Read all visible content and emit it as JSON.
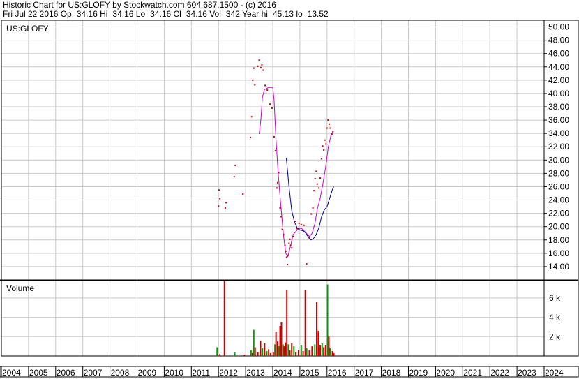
{
  "header": {
    "line1": "Historic Chart for US:GLOFY by Stockwatch.com 604.687.1500 - (c) 2016",
    "line2": "Fri Jul 22 2016  Op=34.16  Hi=34.16  Lo=34.16  Cl=34.16  Vol=342  Year hi=45.13  lo=13.52"
  },
  "colors": {
    "grid": "#c8c8c8",
    "price": "#cc0000",
    "ma_fast": "#cc00cc",
    "ma_slow": "#000099",
    "vol_up": "#00a000",
    "vol_down": "#cc0000",
    "frame": "#000000"
  },
  "chart_data": [
    {
      "type": "scatter",
      "title": "US:GLOFY",
      "ylim": [
        12,
        51
      ],
      "xlim": [
        2004,
        2024
      ],
      "y_ticks": [
        "14.00",
        "16.00",
        "18.00",
        "20.00",
        "22.00",
        "24.00",
        "26.00",
        "28.00",
        "30.00",
        "32.00",
        "34.00",
        "36.00",
        "38.00",
        "40.00",
        "42.00",
        "44.00",
        "46.00",
        "48.00",
        "50.00"
      ],
      "grid": true,
      "series": [
        {
          "kind": "price",
          "points": [
            [
              2012.0,
              23.1
            ],
            [
              2012.02,
              25.5
            ],
            [
              2012.05,
              24.2
            ],
            [
              2012.25,
              22.8
            ],
            [
              2012.28,
              23.6
            ],
            [
              2012.58,
              27.5
            ],
            [
              2012.62,
              29.2
            ],
            [
              2012.9,
              24.9
            ],
            [
              2013.18,
              33.4
            ],
            [
              2013.22,
              36.5
            ],
            [
              2013.26,
              42.0
            ],
            [
              2013.3,
              43.8
            ],
            [
              2013.34,
              41.3
            ],
            [
              2013.45,
              44.1
            ],
            [
              2013.5,
              45.0
            ],
            [
              2013.56,
              43.9
            ],
            [
              2013.6,
              44.3
            ],
            [
              2013.65,
              43.5
            ],
            [
              2013.72,
              41.2
            ],
            [
              2013.8,
              40.5
            ],
            [
              2013.9,
              38.4
            ],
            [
              2013.97,
              37.8
            ],
            [
              2014.05,
              33.5
            ],
            [
              2014.1,
              31.4
            ],
            [
              2014.15,
              25.8
            ],
            [
              2014.18,
              26.6
            ],
            [
              2014.22,
              28.1
            ],
            [
              2014.27,
              22.8
            ],
            [
              2014.31,
              21.5
            ],
            [
              2014.35,
              19.6
            ],
            [
              2014.4,
              18.8
            ],
            [
              2014.45,
              17.2
            ],
            [
              2014.48,
              16.3
            ],
            [
              2014.51,
              15.4
            ],
            [
              2014.54,
              14.3
            ],
            [
              2014.57,
              15.7
            ],
            [
              2014.6,
              17.5
            ],
            [
              2014.63,
              18.1
            ],
            [
              2014.66,
              17.2
            ],
            [
              2014.7,
              16.8
            ],
            [
              2014.75,
              18.5
            ],
            [
              2014.82,
              20.8
            ],
            [
              2014.9,
              19.7
            ],
            [
              2014.97,
              20.5
            ],
            [
              2015.05,
              20.3
            ],
            [
              2015.15,
              20.2
            ],
            [
              2015.25,
              14.4
            ],
            [
              2015.35,
              18.3
            ],
            [
              2015.42,
              21.9
            ],
            [
              2015.48,
              22.8
            ],
            [
              2015.52,
              25.4
            ],
            [
              2015.56,
              27.2
            ],
            [
              2015.6,
              28.3
            ],
            [
              2015.64,
              26.4
            ],
            [
              2015.7,
              25.8
            ],
            [
              2015.75,
              27.3
            ],
            [
              2015.8,
              30.2
            ],
            [
              2015.84,
              32.1
            ],
            [
              2015.88,
              31.5
            ],
            [
              2015.92,
              33.0
            ],
            [
              2015.96,
              32.4
            ],
            [
              2016.0,
              34.8
            ],
            [
              2016.04,
              36.0
            ],
            [
              2016.08,
              35.4
            ],
            [
              2016.12,
              34.8
            ],
            [
              2016.18,
              33.9
            ],
            [
              2016.22,
              34.3
            ]
          ]
        },
        {
          "kind": "ma_fast",
          "points": [
            [
              2013.5,
              33.9
            ],
            [
              2013.56,
              36.0
            ],
            [
              2013.62,
              39.5
            ],
            [
              2013.7,
              40.6
            ],
            [
              2013.85,
              40.9
            ],
            [
              2014.0,
              40.9
            ],
            [
              2014.05,
              39.0
            ],
            [
              2014.12,
              33.0
            ],
            [
              2014.2,
              28.0
            ],
            [
              2014.3,
              23.0
            ],
            [
              2014.4,
              18.5
            ],
            [
              2014.48,
              16.0
            ],
            [
              2014.55,
              15.5
            ],
            [
              2014.65,
              17.0
            ],
            [
              2014.75,
              18.8
            ],
            [
              2014.9,
              19.5
            ],
            [
              2015.05,
              19.8
            ],
            [
              2015.2,
              19.2
            ],
            [
              2015.35,
              18.5
            ],
            [
              2015.45,
              19.0
            ],
            [
              2015.55,
              20.4
            ],
            [
              2015.65,
              22.8
            ],
            [
              2015.75,
              24.3
            ],
            [
              2015.85,
              26.5
            ],
            [
              2015.95,
              29.0
            ],
            [
              2016.05,
              32.0
            ],
            [
              2016.15,
              33.8
            ],
            [
              2016.22,
              34.3
            ]
          ]
        },
        {
          "kind": "ma_slow",
          "points": [
            [
              2014.5,
              30.3
            ],
            [
              2014.6,
              26.0
            ],
            [
              2014.7,
              22.4
            ],
            [
              2014.8,
              20.7
            ],
            [
              2014.9,
              19.8
            ],
            [
              2015.0,
              19.5
            ],
            [
              2015.1,
              19.4
            ],
            [
              2015.2,
              19.1
            ],
            [
              2015.3,
              18.5
            ],
            [
              2015.4,
              18.0
            ],
            [
              2015.5,
              18.2
            ],
            [
              2015.6,
              18.8
            ],
            [
              2015.7,
              19.8
            ],
            [
              2015.8,
              21.5
            ],
            [
              2015.9,
              22.5
            ],
            [
              2016.0,
              23.0
            ],
            [
              2016.1,
              24.3
            ],
            [
              2016.2,
              25.6
            ],
            [
              2016.25,
              26.0
            ]
          ]
        }
      ]
    },
    {
      "type": "bar",
      "title": "Volume",
      "ylim": [
        0,
        7.8
      ],
      "y_ticks": [
        "2 k",
        "4 k",
        "6 k"
      ],
      "x_ticks": [
        "2004",
        "2005",
        "2006",
        "2007",
        "2008",
        "2009",
        "2010",
        "2011",
        "2012",
        "2013",
        "2014",
        "2015",
        "2016",
        "2017",
        "2018",
        "2019",
        "2020",
        "2021",
        "2022",
        "2023",
        "2024"
      ],
      "bars": [
        [
          2011.95,
          0.9,
          "up"
        ],
        [
          2012.05,
          0.2,
          "down"
        ],
        [
          2012.22,
          7.75,
          "down"
        ],
        [
          2012.6,
          0.35,
          "up"
        ],
        [
          2012.95,
          0.15,
          "down"
        ],
        [
          2013.2,
          0.6,
          "up"
        ],
        [
          2013.25,
          0.3,
          "down"
        ],
        [
          2013.3,
          2.7,
          "up"
        ],
        [
          2013.35,
          0.9,
          "down"
        ],
        [
          2013.45,
          0.4,
          "down"
        ],
        [
          2013.55,
          1.6,
          "down"
        ],
        [
          2013.62,
          0.8,
          "up"
        ],
        [
          2013.7,
          1.3,
          "down"
        ],
        [
          2013.78,
          0.5,
          "up"
        ],
        [
          2013.85,
          0.7,
          "down"
        ],
        [
          2013.92,
          0.3,
          "down"
        ],
        [
          2014.02,
          0.4,
          "down"
        ],
        [
          2014.08,
          1.2,
          "up"
        ],
        [
          2014.12,
          2.5,
          "down"
        ],
        [
          2014.18,
          1.5,
          "down"
        ],
        [
          2014.22,
          1.0,
          "up"
        ],
        [
          2014.27,
          3.1,
          "down"
        ],
        [
          2014.32,
          3.5,
          "down"
        ],
        [
          2014.38,
          1.2,
          "up"
        ],
        [
          2014.42,
          1.0,
          "down"
        ],
        [
          2014.47,
          1.4,
          "down"
        ],
        [
          2014.52,
          6.8,
          "down"
        ],
        [
          2014.58,
          1.2,
          "up"
        ],
        [
          2014.63,
          0.6,
          "down"
        ],
        [
          2014.7,
          1.3,
          "down"
        ],
        [
          2014.78,
          1.0,
          "up"
        ],
        [
          2014.85,
          0.4,
          "down"
        ],
        [
          2014.95,
          0.6,
          "down"
        ],
        [
          2015.05,
          1.1,
          "up"
        ],
        [
          2015.12,
          0.5,
          "down"
        ],
        [
          2015.2,
          6.8,
          "down"
        ],
        [
          2015.25,
          0.8,
          "up"
        ],
        [
          2015.35,
          0.6,
          "down"
        ],
        [
          2015.45,
          1.0,
          "down"
        ],
        [
          2015.55,
          1.2,
          "up"
        ],
        [
          2015.62,
          5.6,
          "down"
        ],
        [
          2015.68,
          2.6,
          "down"
        ],
        [
          2015.75,
          1.1,
          "down"
        ],
        [
          2015.82,
          1.3,
          "up"
        ],
        [
          2015.88,
          0.9,
          "down"
        ],
        [
          2015.95,
          1.1,
          "down"
        ],
        [
          2016.02,
          7.4,
          "up"
        ],
        [
          2016.07,
          2.0,
          "down"
        ],
        [
          2016.12,
          0.8,
          "up"
        ],
        [
          2016.2,
          0.5,
          "down"
        ],
        [
          2016.25,
          0.3,
          "down"
        ]
      ]
    }
  ]
}
